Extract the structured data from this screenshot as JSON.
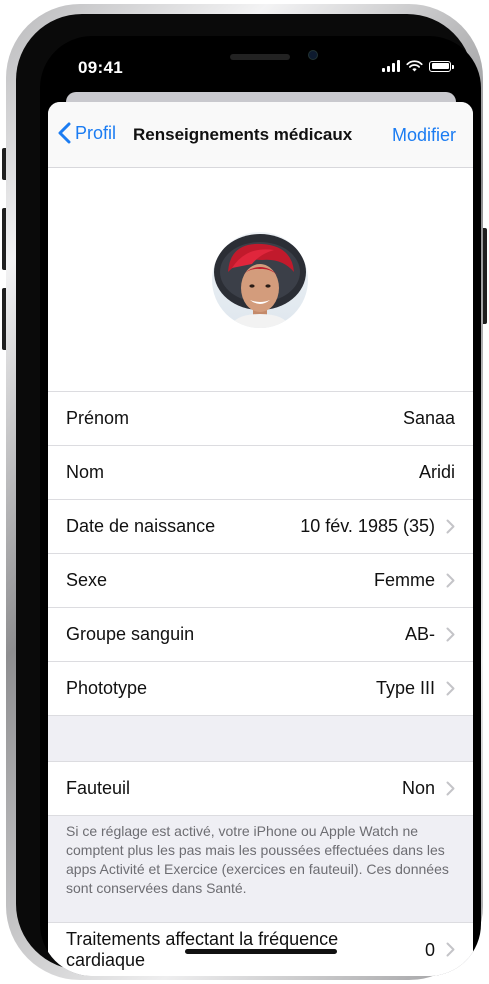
{
  "status_bar": {
    "time": "09:41"
  },
  "nav": {
    "back_label": "Profil",
    "title": "Renseignements médicaux",
    "edit_label": "Modifier"
  },
  "fields": [
    {
      "label": "Prénom",
      "value": "Sanaa"
    },
    {
      "label": "Nom",
      "value": "Aridi"
    },
    {
      "label": "Date de naissance",
      "value": "10 fév. 1985 (35)"
    },
    {
      "label": "Sexe",
      "value": "Femme"
    },
    {
      "label": "Groupe sanguin",
      "value": "AB-"
    },
    {
      "label": "Phototype",
      "value": "Type III"
    }
  ],
  "wheelchair": {
    "label": "Fauteuil",
    "value": "Non"
  },
  "wheelchair_note": "Si ce réglage est activé, votre iPhone ou Apple Watch ne comptent plus les pas mais les poussées effectuées dans les apps Activité et Exercice (exercices en fauteuil). Ces données sont conservées dans Santé.",
  "heart_rate_meds": {
    "label": "Traitements affectant la fréquence cardiaque",
    "value": "0"
  },
  "colors": {
    "accent": "#1b7cf2",
    "background": "#efeff4"
  },
  "icons": {
    "back": "chevron-left-icon",
    "row_disclosure": "chevron-right-icon"
  }
}
